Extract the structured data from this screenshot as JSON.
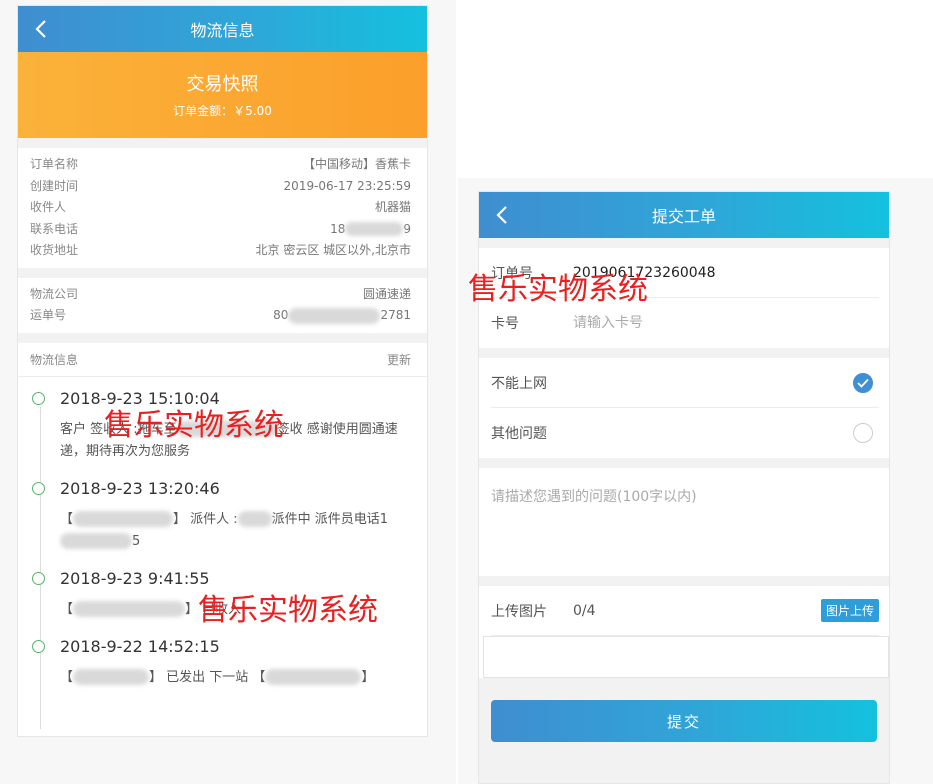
{
  "logistics_page": {
    "title": "物流信息",
    "snapshot": {
      "title": "交易快照",
      "amount": "订单金额：￥5.00"
    },
    "order": [
      {
        "label": "订单名称",
        "value": "【中国移动】香蕉卡"
      },
      {
        "label": "创建时间",
        "value": "2019-06-17 23:25:59"
      },
      {
        "label": "收件人",
        "value": "机器猫"
      },
      {
        "label": "联系电话",
        "value_prefix": "18",
        "value_suffix": "9"
      },
      {
        "label": "收货地址",
        "value": "北京 密云区 城区以外,北京市"
      }
    ],
    "shipping": [
      {
        "label": "物流公司",
        "value": "圆通速递"
      },
      {
        "label": "运单号",
        "value_prefix": "80",
        "value_suffix": "2781"
      }
    ],
    "log_header": {
      "label": "物流信息",
      "action": "更新"
    },
    "log": [
      {
        "time": "2018-9-23 15:10:04",
        "desc_a": "客户 签收人 :拖车至",
        "desc_b": "签收 感谢使用圆通速递，期待再次为您服务"
      },
      {
        "time": "2018-9-23 13:20:46",
        "desc_a": "【",
        "desc_b": "】 派件人 :",
        "desc_c": "派件中 派件员电话1",
        "desc_d": "5"
      },
      {
        "time": "2018-9-23 9:41:55",
        "desc_a": "【",
        "desc_b": "】 已收入"
      },
      {
        "time": "2018-9-22 14:52:15",
        "desc_a": "【",
        "desc_b": "】 已发出 下一站 【",
        "desc_c": "】"
      }
    ]
  },
  "ticket_page": {
    "title": "提交工单",
    "order_no": {
      "label": "订单号",
      "value": "2019061723260048"
    },
    "card_no": {
      "label": "卡号",
      "placeholder": "请输入卡号"
    },
    "issues": [
      {
        "label": "不能上网",
        "selected": true
      },
      {
        "label": "其他问题",
        "selected": false
      }
    ],
    "description_placeholder": "请描述您遇到的问题(100字以内)",
    "upload": {
      "label": "上传图片",
      "count": "0/4",
      "button": "图片上传"
    },
    "submit": "提交"
  },
  "watermarks": [
    "售乐实物系统",
    "售乐实物系统",
    "售乐实物系统"
  ],
  "colors": {
    "header_gradient_start": "#3f8ed0",
    "header_gradient_end": "#14c1de",
    "snapshot_orange": "#fba62f",
    "watermark_red": "#e8201f",
    "timeline_dot": "#5bb36a"
  }
}
